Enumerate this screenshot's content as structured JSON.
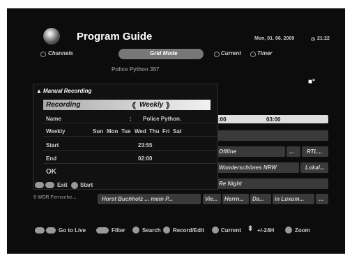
{
  "header": {
    "title": "Program Guide",
    "datetime": "Mon, 01. 06. 2009",
    "clock": "21:22"
  },
  "modes": {
    "channels": "Channels",
    "grid": "Grid Mode",
    "current": "Current",
    "timer": "Timer"
  },
  "behind": {
    "top_title": "Police Python 357",
    "time_a": ":00",
    "time_b": "03:00",
    "row1": "Offline",
    "dots": "...",
    "rtl": "RTL...",
    "row2": "Wanderschönes NRW",
    "lokal": "Lokal...",
    "row3": "Re Night",
    "arrow": "...",
    "bottom_row": [
      "Horst Buchholz ... mein P...",
      "Vie...",
      "Herrn...",
      "Da...",
      "in Luxum...",
      "..."
    ],
    "left_bottom": "9 WDR Fernsehe..."
  },
  "dialog": {
    "title": "Manual Recording",
    "recording_label": "Recording",
    "recording_value": "Weekly",
    "name_label": "Name",
    "name_colon": ":",
    "name_value": "Police Python.",
    "weekly_label": "Weekly",
    "days": [
      "Sun",
      "Mon",
      "Tue",
      "Wed",
      "Thu",
      "Fri",
      "Sat"
    ],
    "start_label": "Start",
    "start_value": "23:55",
    "end_label": "End",
    "end_value": "02:00",
    "ok_label": "OK",
    "footer_exit": "Exit",
    "footer_start": "Start"
  },
  "footer": {
    "go_live": "Go to Live",
    "filter": "Filter",
    "search": "Search",
    "record": "Record/Edit",
    "current": "Current",
    "channel": "+/-24H",
    "zoom": "Zoom"
  }
}
